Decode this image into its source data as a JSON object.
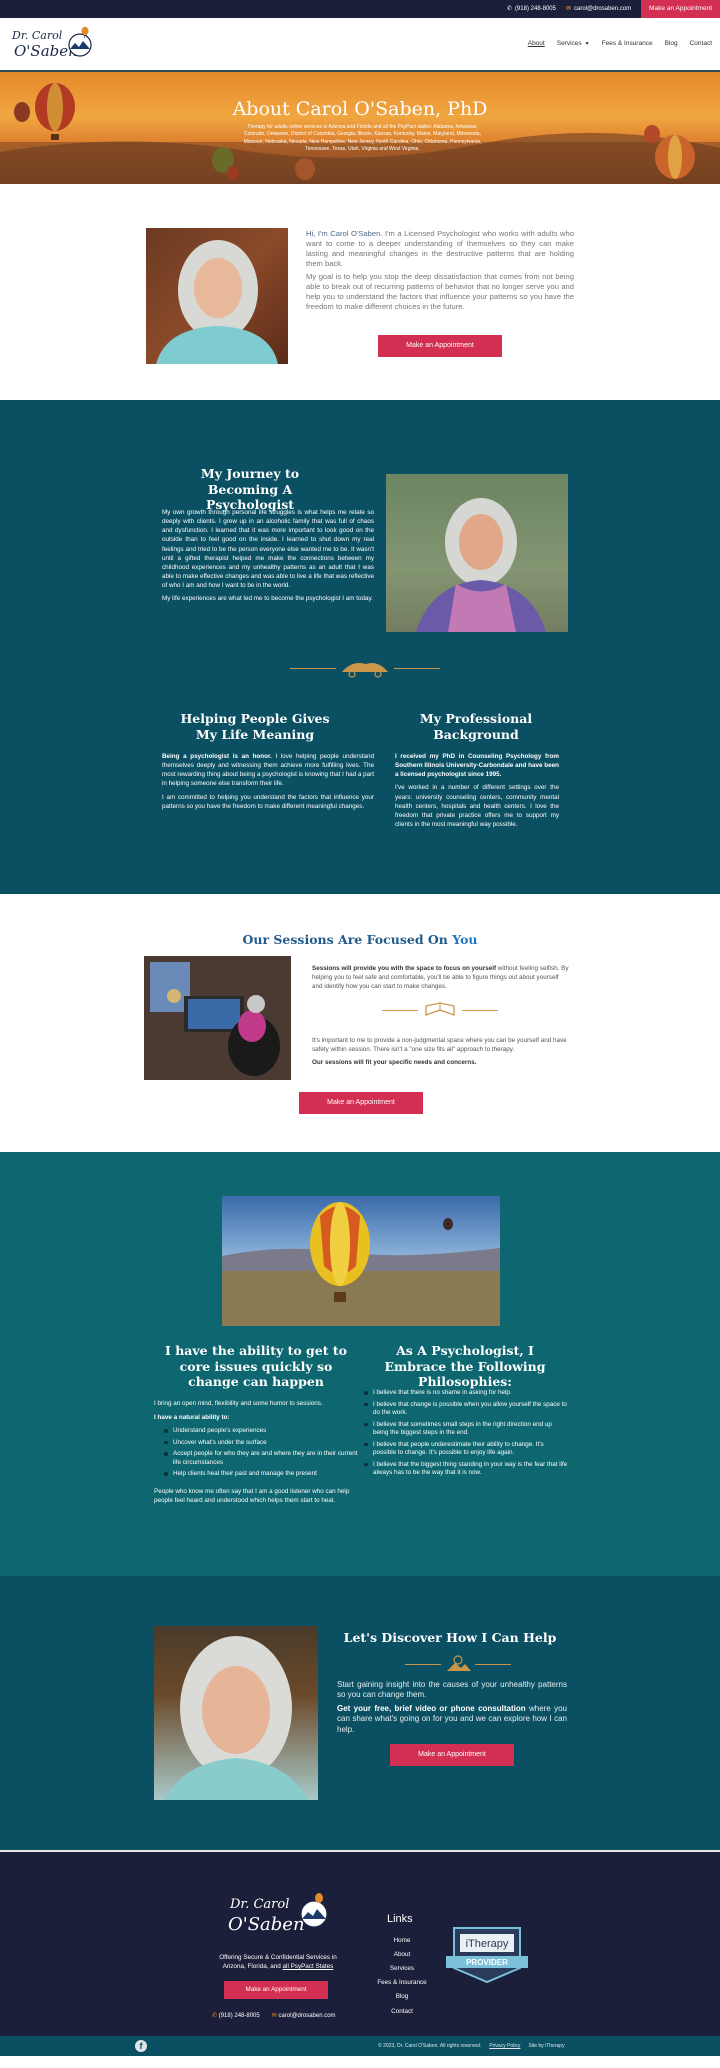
{
  "topbar": {
    "phone": "(918) 248-8005",
    "email": "carol@drosaben.com",
    "cta": "Make an Appointment"
  },
  "logo": {
    "line1": "Dr. Carol",
    "line2": "O'Saben"
  },
  "nav": {
    "items": [
      "About",
      "Services",
      "Fees & Insurance",
      "Blog",
      "Contact"
    ]
  },
  "hero": {
    "title": "About Carol O'Saben, PhD",
    "subtitle": "Therapy for adults online services in Arizona and Florida and all the PsyPact states: Alabama, Arkansas, Colorado, Delaware, District of Columbia, Georgia, Illinois, Kansas, Kentucky, Maine, Maryland, Minnesota, Missouri, Nebraska, Nevada, New Hampshire, New Jersey, North Carolina, Ohio, Oklahoma, Pennsylvania, Tennessee, Texas, Utah, Virginia and West Virginia."
  },
  "intro": {
    "p1_lead": "Hi, I'm Carol O'Saben.",
    "p1_rest": " I'm a Licensed Psychologist who works with adults who want to come to a deeper understanding of themselves so they can make lasting and meaningful changes in the destructive patterns that are holding them back.",
    "p2": "My goal is to help you stop the deep dissatisfaction that comes from not being able to break out of recurring patterns of behavior that no longer serve you and help you to understand the factors that influence your patterns so you have the freedom to make different choices in the future.",
    "button": "Make an Appointment"
  },
  "journey": {
    "title": "My Journey to Becoming A Psychologist",
    "p1": "My own growth through personal life struggles is what helps me relate so deeply with clients. I grew up in an alcoholic family that was full of chaos and dysfunction. I learned that it was more important to look good on the outside than to feel good on the inside. I learned to shut down my real feelings and tried to be the person everyone else wanted me to be. It wasn't until a gifted therapist helped me make the connections between my childhood experiences and my unhealthy patterns as an adult that I was able to make effective changes and was able to live a life that was reflective of who I am and how I want to be in the world.",
    "p2": "My life experiences are what led me to become the psychologist I am today.",
    "helping_title": "Helping People Gives My Life Meaning",
    "helping_lead": "Being a psychologist is an honor.",
    "helping_p1": " I love helping people understand themselves deeply and witnessing them achieve more fulfilling lives. The most rewarding thing about being a psychologist is knowing that I had a part in helping someone else transform their life.",
    "helping_p2": "I am committed to helping you understand the factors that influence your patterns so you have the freedom to make different meaningful changes.",
    "prof_title": "My Professional Background",
    "prof_lead": "I received my PhD in Counseling Psychology from Southern Illinois University-Carbondale and have been a licensed psychologist since 1995.",
    "prof_p": "I've worked in a number of different settings over the years: university counseling centers, community mental health centers, hospitals and health centers. I love the freedom that private practice offers me to support my clients in the most meaningful way possible."
  },
  "sessions": {
    "title_a": "Our Sessions Are Focused On ",
    "title_b": "You",
    "p1_lead": "Sessions will provide you with the space to focus on yourself",
    "p1_rest": " without feeling selfish. By helping you to feel safe and comfortable, you'll be able to figure things out about yourself and identify how you can start to make changes.",
    "p2": "It's important to me to provide a non-judgmental space where you can be yourself and have safety within session. There isn't a \"one size fits all\" approach to therapy.",
    "p3": "Our sessions will fit your specific needs and concerns.",
    "button": "Make an Appointment"
  },
  "ability": {
    "title": "I have the ability to get to core issues quickly so change can happen",
    "p1": "I bring an open mind, flexibility and some humor to sessions.",
    "list_title": "I have a natural ability to:",
    "list": [
      "Understand people's experiences",
      "Uncover what's under the surface",
      "Accept people for who they are and where they are in their current life circumstances",
      "Help clients heal their past and manage the present"
    ],
    "p2": "People who know me often say that I am a good listener who can help people feel heard and understood which helps them start to heal.",
    "phil_title": "As A Psychologist, I Embrace the Following Philosophies:",
    "phil": [
      "I believe that there is no shame in asking for help.",
      "I believe that change is possible when you allow yourself the space to do the work.",
      "I believe that sometimes small steps in the right direction end up being the biggest steps in the end.",
      "I believe that people underestimate their ability to change. It's possible to change. It's possible to enjoy life again.",
      "I believe that the biggest thing standing in your way is the fear that life always has to be the way that it is now."
    ]
  },
  "discover": {
    "title": "Let's Discover How I Can Help",
    "p1": "Start gaining insight into the causes of your unhealthy patterns so you can change them.",
    "p2_lead": "Get your free, brief video or phone consultation",
    "p2_rest": " where you can share what's going on for you and we can explore how I can help.",
    "button": "Make an Appointment"
  },
  "footer": {
    "tagline_a": "Offering Secure & Confidential Services in",
    "tagline_b": "Arizona, Florida, and ",
    "tagline_link": "all PsyPact States",
    "button": "Make an Appointment",
    "phone": "(918) 248-8005",
    "email": "carol@drosaben.com",
    "links_title": "Links",
    "links": [
      "Home",
      "About",
      "Services",
      "Fees & Insurance",
      "Blog",
      "Contact"
    ],
    "badge_top": "iTherapy",
    "badge_bottom": "PROVIDER"
  },
  "bottombar": {
    "copyright": "© 2023, Dr. Carol O'Saben. All rights reserved.",
    "privacy": "Privacy Policy",
    "siteby": "Site by iTherapy"
  },
  "colors": {
    "navy": "#1c1f3a",
    "teal_dark": "#0b4f63",
    "teal": "#0e6670",
    "accent_red": "#d32f52",
    "gold": "#c9964a",
    "link_blue": "#1f78c1"
  }
}
